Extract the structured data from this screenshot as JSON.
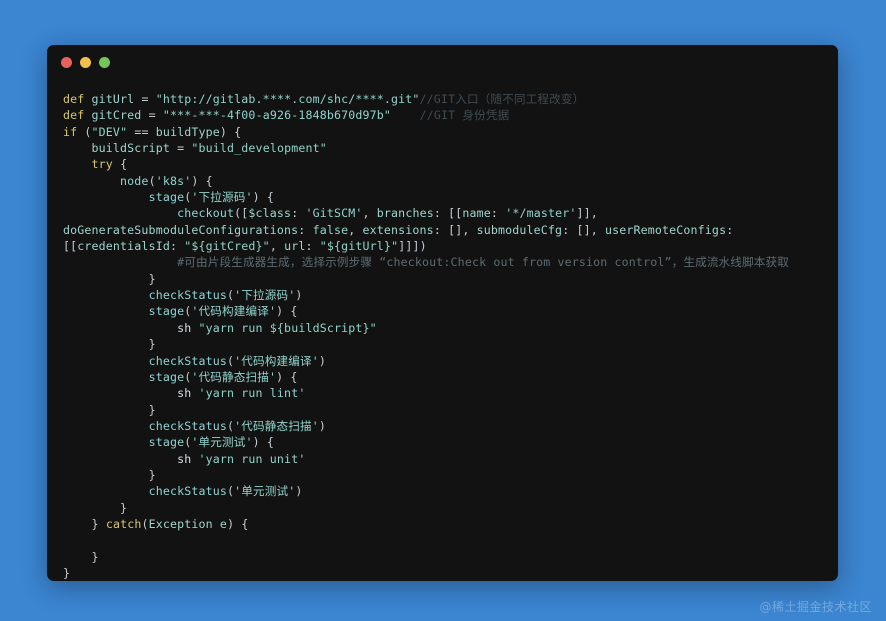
{
  "page": {
    "background_color": "#3b85d1"
  },
  "window": {
    "title": "",
    "background_color": "#121212",
    "controls": [
      {
        "name": "close",
        "color": "#e9615d"
      },
      {
        "name": "minimize",
        "color": "#f2c14b"
      },
      {
        "name": "maximize",
        "color": "#74c757"
      }
    ]
  },
  "watermark": {
    "text": "@稀土掘金技术社区"
  },
  "code": {
    "language": "groovy",
    "lines": [
      "def gitUrl = \"http://gitlab.****.com/shc/****.git\"//GIT入口（随不同工程改变）",
      "def gitCred = \"***-***-4f00-a926-1848b670d97b\"    //GIT 身份凭据",
      "if (\"DEV\" == buildType) {",
      "    buildScript = \"build_development\"",
      "    try {",
      "        node('k8s') {",
      "            stage('下拉源码') {",
      "                checkout([$class: 'GitSCM', branches: [[name: '*/master']],",
      "doGenerateSubmoduleConfigurations: false, extensions: [], submoduleCfg: [], userRemoteConfigs:",
      "[[credentialsId: \"${gitCred}\", url: \"${gitUrl}\"]]])",
      "                #可由片段生成器生成，选择示例步骤 “checkout:Check out from version control”，生成流水线脚本获取",
      "            }",
      "            checkStatus('下拉源码')",
      "            stage('代码构建编译') {",
      "                sh \"yarn run ${buildScript}\"",
      "            }",
      "            checkStatus('代码构建编译')",
      "            stage('代码静态扫描') {",
      "                sh 'yarn run lint'",
      "            }",
      "            checkStatus('代码静态扫描')",
      "            stage('单元测试') {",
      "                sh 'yarn run unit'",
      "            }",
      "            checkStatus('单元测试')",
      "        }",
      "    } catch(Exception e) {",
      "",
      "    }",
      "}"
    ],
    "tokens": {
      "keywords": [
        "def",
        "if",
        "try",
        "catch"
      ],
      "functions": [
        "node",
        "stage",
        "checkout",
        "checkStatus",
        "sh"
      ],
      "variables": [
        "gitUrl",
        "gitCred",
        "buildType",
        "buildScript",
        "Exception",
        "e"
      ],
      "strings": [
        "\"http://gitlab.****.com/shc/****.git\"",
        "\"***-***-4f00-a926-1848b670d97b\"",
        "\"DEV\"",
        "\"build_development\"",
        "'k8s'",
        "'下拉源码'",
        "'GitSCM'",
        "'*/master'",
        "\"${gitCred}\"",
        "\"${gitUrl}\"",
        "'代码构建编译'",
        "\"yarn run ${buildScript}\"",
        "'代码静态扫描'",
        "'yarn run lint'",
        "'单元测试'",
        "'yarn run unit'"
      ],
      "comments": [
        "//GIT入口（随不同工程改变）",
        "//GIT 身份凭据",
        "#可由片段生成器生成，选择示例步骤 “checkout:Check out from version control”，生成流水线脚本获取"
      ],
      "properties": [
        "$class",
        "branches",
        "name",
        "doGenerateSubmoduleConfigurations",
        "extensions",
        "submoduleCfg",
        "userRemoteConfigs",
        "credentialsId",
        "url"
      ],
      "literals": [
        "false"
      ]
    },
    "colors": {
      "keyword": "#d8c76a",
      "function": "#8fd4d4",
      "string": "#8fd4cc",
      "comment": "#3f4b52",
      "hash_comment": "#5c6b72",
      "punctuation": "#c5ccd2",
      "variable": "#9fd4d0",
      "default": "#c8cdd2"
    }
  }
}
